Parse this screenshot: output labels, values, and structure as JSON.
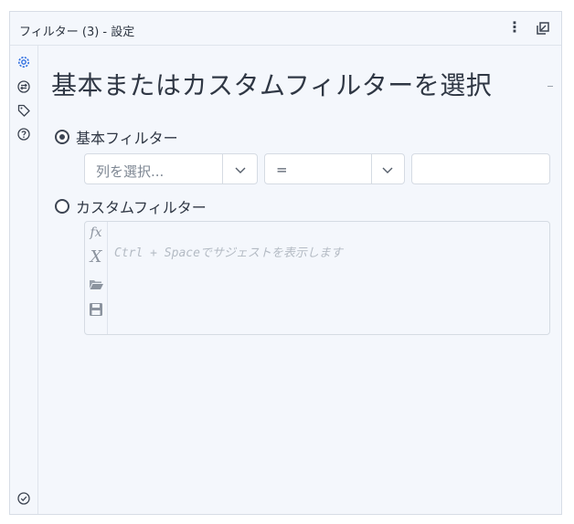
{
  "window": {
    "title": "フィルター (3) - 設定",
    "menu_icon": "more-vertical-icon",
    "popout_icon": "popout-icon"
  },
  "left_rail": {
    "icons": [
      "gear-icon",
      "swap-icon",
      "tag-icon",
      "help-icon"
    ],
    "bottom_icon": "check-circle-icon"
  },
  "main": {
    "heading": "基本またはカスタムフィルターを選択",
    "basic_filter": {
      "label": "基本フィルター",
      "selected": true,
      "column_select": {
        "placeholder": "列を選択..."
      },
      "operator_select": {
        "value": "="
      },
      "value_input": {
        "value": ""
      }
    },
    "custom_filter": {
      "label": "カスタムフィルター",
      "selected": false,
      "editor_placeholder": "Ctrl + Spaceでサジェストを表示します",
      "gutter": [
        {
          "icon": "function-icon",
          "glyph": "fx"
        },
        {
          "icon": "variable-icon",
          "glyph": "X"
        },
        {
          "icon": "folder-open-icon"
        },
        {
          "icon": "save-icon"
        }
      ]
    }
  },
  "colors": {
    "panel_bg": "#f4f7fc",
    "border": "#d5dbe3",
    "accent": "#2f6fe0",
    "text": "#2f3744"
  }
}
